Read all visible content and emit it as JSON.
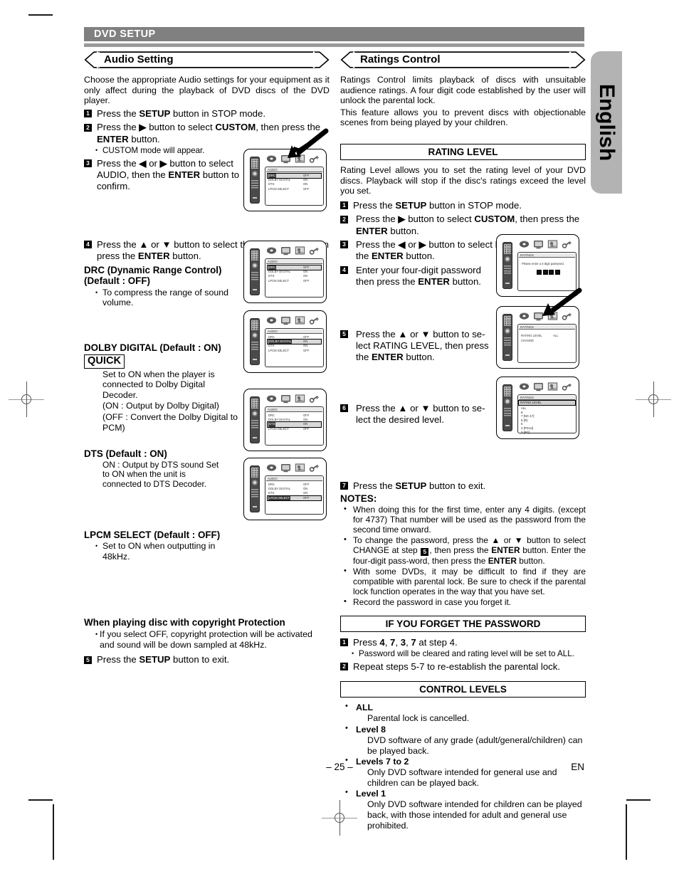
{
  "header": {
    "title": "DVD SETUP"
  },
  "lang_tab": {
    "label": "English"
  },
  "footer": {
    "page": "– 25 –",
    "lang_code": "EN"
  },
  "left": {
    "banner": "Audio Setting",
    "intro": "Choose the appropriate Audio settings for your equipment as it only affect during the playback of DVD discs of the DVD player.",
    "steps": [
      {
        "n": "1",
        "text": "Press the SETUP button in STOP mode.",
        "html": "Press the <b>SETUP</b> button in STOP mode."
      },
      {
        "n": "2",
        "text": "Press the ▶ button to select CUSTOM, then press the ENTER button.",
        "html": "Press the <b>▶</b> button to select <b>CUSTOM</b>, then press the <b>ENTER</b> button."
      },
      {
        "n": "3",
        "text": "Press the ◀ or ▶ button to select AUDIO, then the ENTER button to confirm.",
        "html": "Press the <b>◀</b> or <b>▶</b> button to select AUDIO, then the <b>ENTER</b> button to confirm."
      },
      {
        "n": "4",
        "text": "Press the ▲ or ▼ button to select the below items, then press the ENTER button.",
        "html": "Press the <b>▲</b> or <b>▼</b> button to select the below items, then press the <b>ENTER</b> button."
      },
      {
        "n": "5",
        "text": "Press the SETUP button to exit.",
        "html": "Press the <b>SETUP</b> button to exit."
      }
    ],
    "step2_sub": "CUSTOM mode will appear.",
    "settings": [
      {
        "title": "DRC (Dynamic Range Control)\n(Default : OFF)",
        "title_html": "DRC (Dynamic Range Control)<br>(Default : OFF)",
        "lines": [
          "To compress the range of sound volume."
        ],
        "bullet": true,
        "quick": false
      },
      {
        "title": "DOLBY DIGITAL (Default : ON)",
        "title_html": "DOLBY DIGITAL (Default : ON)",
        "quick_label": "QUICK",
        "quick": true,
        "lines": [
          "Set to ON when the player is connected to Dolby Digital Decoder.",
          "(ON : Output by Dolby Digital)",
          "(OFF : Convert the Dolby Digital to PCM)"
        ],
        "bullet": false
      },
      {
        "title": "DTS (Default : ON)",
        "title_html": "DTS (Default : ON)",
        "lines": [
          "ON : Output by DTS sound Set to ON when the unit is connected to DTS Decoder."
        ],
        "bullet": false,
        "quick": false
      },
      {
        "title": "LPCM SELECT (Default : OFF)",
        "title_html": "LPCM SELECT (Default : OFF)",
        "lines": [
          "Set to ON when outputting in 48kHz."
        ],
        "bullet": true,
        "quick": false
      }
    ],
    "copyright_head": "When playing disc with copyright Protection",
    "copyright_text": "If you select OFF, copyright protection will be activated and sound will be down sampled at 48kHz."
  },
  "right": {
    "banner": "Ratings Control",
    "intro1": "Ratings Control limits playback of discs with unsuitable audience ratings. A four digit code established by the user will unlock the parental lock.",
    "intro2": "This feature allows you to prevent discs with objectionable scenes from being played by your children.",
    "rating_level_head": "RATING LEVEL",
    "rating_level_intro": "Rating Level allows you to set the rating level of your DVD discs. Playback will stop if the disc's ratings exceed the level you set.",
    "steps": [
      {
        "n": "1",
        "html": "Press the <b>SETUP</b> button in STOP mode."
      },
      {
        "n": "2",
        "html": "Press the <b>▶</b> button to select <b>CUSTOM</b>, then press the <b>ENTER</b> button."
      },
      {
        "n": "3",
        "html": "Press the <b>◀</b> or <b>▶</b> button to select RATING, then press the <b>ENTER</b> button."
      },
      {
        "n": "4",
        "html": "Enter your four-digit password then press the <b>ENTER</b> button."
      },
      {
        "n": "5",
        "html": "Press the <b>▲</b> or <b>▼</b> button to select RATING LEVEL, then press the <b>ENTER</b> button."
      },
      {
        "n": "6",
        "html": "Press the <b>▲</b> or <b>▼</b> button to select the desired level."
      },
      {
        "n": "7",
        "html": "Press the <b>SETUP</b> button to exit."
      }
    ],
    "notes_head": "NOTES:",
    "notes": [
      "When doing this for the first time, enter any 4 digits. (except for 4737) That number will be used as the password from the second time onward.",
      "To change the password, press the ▲ or ▼ button to select CHANGE at step 5, then press the ENTER button. Enter the four-digit pass-word, then press the ENTER button.",
      "With some DVDs, it may be difficult to find if they are compatible with parental lock. Be sure to check if the parental lock function operates in the way that you have set.",
      "Record the password in case you forget it."
    ],
    "forgot_head": "IF YOU FORGET THE PASSWORD",
    "forgot_steps": [
      {
        "n": "1",
        "html": "Press <b>4</b>, <b>7</b>, <b>3</b>, <b>7</b> at step 4."
      },
      {
        "n": "2",
        "html": "Repeat steps 5-7 to re-establish the parental lock."
      }
    ],
    "forgot_sub": "Password will be cleared and rating level will be set to ALL.",
    "control_levels_head": "CONTROL LEVELS",
    "control_levels": [
      {
        "label": "ALL",
        "desc": "Parental lock is cancelled."
      },
      {
        "label": "Level 8",
        "desc": "DVD software of any grade (adult/general/children) can be played back."
      },
      {
        "label": "Levels 7 to 2",
        "desc": "Only DVD software intended for general use and children can be played back."
      },
      {
        "label": "Level 1",
        "desc": "Only DVD software intended for children can be played back, with those intended for adult and general use prohibited."
      }
    ]
  },
  "screens": {
    "audio_menu_title": "AUDIO",
    "ratings_menu_title": "RATINGS",
    "audio_rows": [
      {
        "label": "DRC",
        "value": "OFF"
      },
      {
        "label": "DOLBY DIGITAL",
        "value": "ON"
      },
      {
        "label": "DTS",
        "value": "ON"
      },
      {
        "label": "LPCM SELECT",
        "value": "OFF"
      }
    ],
    "password_prompt": "Please enter a 4-digit password.",
    "password_digits": 4,
    "ratings_rows": [
      {
        "label": "RATING LEVEL",
        "value": "ALL"
      },
      {
        "label": "CHANGE",
        "value": ""
      }
    ],
    "rating_level_header": "RATING LEVEL",
    "rating_level_list": [
      "ALL",
      "8",
      "7 [NC-17]",
      "6 [R]",
      "5",
      "4 [PG13]",
      "3 [PG]"
    ],
    "icon_names": [
      "disc-icon",
      "tv-icon",
      "preferences-icon",
      "key-icon"
    ],
    "highlighted": {
      "s1": "DRC",
      "s2": "DRC",
      "s3": "DOLBY DIGITAL",
      "s4": "DTS",
      "s5": "LPCM SELECT"
    }
  },
  "colors": {
    "header_bar": "#808080",
    "header_rule": "#9a9a9a",
    "lang_tab": "#b3b3b3",
    "text": "#000000"
  }
}
